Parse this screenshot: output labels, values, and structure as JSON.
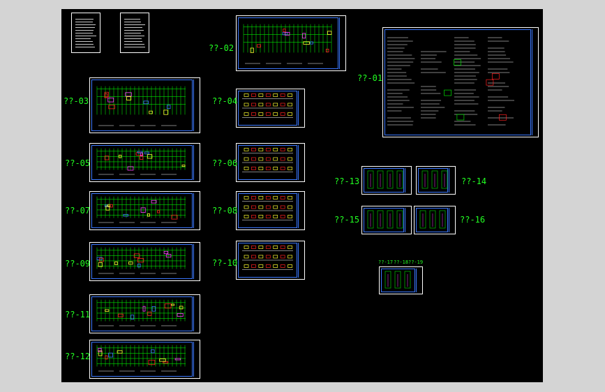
{
  "colors": {
    "background": "#000000",
    "label": "#22ff22",
    "sheet_border": "#ffffff",
    "frame": "#3a78ff",
    "grid": "#00e000",
    "accent_red": "#ff2020",
    "accent_yellow": "#ffff30",
    "accent_magenta": "#ff40ff"
  },
  "labels": {
    "s01": "??-01",
    "s02": "??-02",
    "s03": "??-03",
    "s04": "??-04",
    "s05": "??-05",
    "s06": "??-06",
    "s07": "??-07",
    "s08": "??-08",
    "s09": "??-09",
    "s10": "??-10",
    "s11": "??-11",
    "s12": "??-12",
    "s13": "??-13",
    "s14": "??-14",
    "s15": "??-15",
    "s16": "??-16",
    "s17": "??-17",
    "s18": "??-18",
    "s19": "??-19"
  }
}
